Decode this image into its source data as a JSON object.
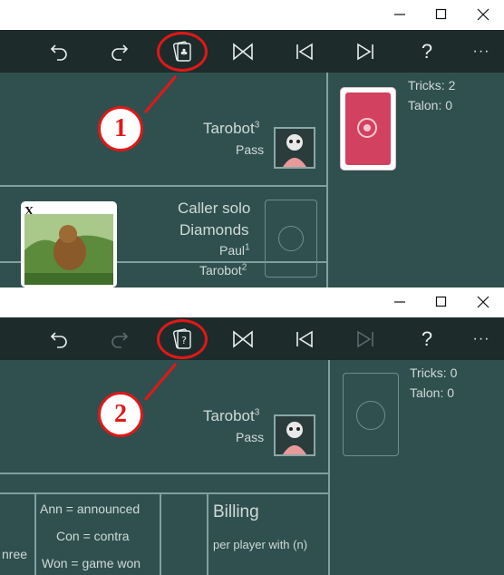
{
  "colors": {
    "toolbar_bg": "#1e2b2b",
    "table_bg": "#2f504f",
    "callout": "#e01818",
    "card_back": "#d2415f"
  },
  "icons": {
    "window": [
      "minimize-icon",
      "maximize-icon",
      "close-icon"
    ],
    "toolbar": [
      "undo-icon",
      "redo-icon",
      "hint-card-icon",
      "swap-icon",
      "skip-back-icon",
      "skip-forward-icon",
      "help-icon",
      "more-icon"
    ]
  },
  "toolbar": {
    "help_label": "?",
    "more_label": "···"
  },
  "screenshot_1": {
    "callout_number": "1",
    "player_name": "Tarobot",
    "player_seat": "3",
    "player_status": "Pass",
    "tricks": "Tricks: 2",
    "talon": "Talon: 0",
    "contract": "Caller solo",
    "suit": "Diamonds",
    "player_paul": "Paul",
    "player_paul_seat": "1",
    "player_tarobot2": "Tarobot",
    "player_tarobot2_seat": "2",
    "card_label": "X",
    "redo_enabled": true,
    "skip_forward_enabled": true
  },
  "screenshot_2": {
    "callout_number": "2",
    "player_name": "Tarobot",
    "player_seat": "3",
    "player_status": "Pass",
    "tricks": "Tricks: 0",
    "talon": "Talon: 0",
    "legend": {
      "left_cut_text": "nree",
      "announced": "Ann = announced",
      "contra": "Con = contra",
      "won": "Won = game won"
    },
    "billing_title": "Billing",
    "billing_sub": "per player with (n)",
    "redo_enabled": false,
    "skip_forward_enabled": false
  }
}
